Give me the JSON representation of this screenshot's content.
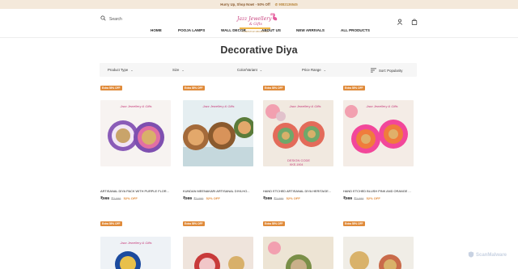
{
  "announcement": {
    "text": "Hurry Up, Shop Now! - 50% Off",
    "phone": "✆ 9082136545"
  },
  "header": {
    "search_label": "Search",
    "logo_text": "Jazz Jewellery & Gifts",
    "logo_subtext": "HOMESTYLE DECORATIVE"
  },
  "nav": [
    "HOME",
    "POOJA LAMPS",
    "WALL DECOR",
    "ABOUT US",
    "NEW ARRIVALS",
    "ALL PRODUCTS"
  ],
  "page_title": "Decorative Diya",
  "filters": {
    "product_type": "Product Type",
    "size": "Size",
    "color": "Color/Variant",
    "price": "Price Range",
    "sort": "Sort: Popularity"
  },
  "products": [
    {
      "badge": "Extra 55% OFF",
      "name": "ARTISANAL DIYA PACK WITH PURPLE FLOR...",
      "price": "₹999",
      "old_price": "₹2,099",
      "discount": "52% OFF",
      "colors": [
        "#8a5cb8",
        "#e26fa4",
        "#d9c03a"
      ]
    },
    {
      "badge": "Extra 55% OFF",
      "name": "KUNDAN MEENAKARI ARTISANAL DIYA HO...",
      "price": "₹999",
      "old_price": "₹2,099",
      "discount": "52% OFF",
      "colors": [
        "#d87a5a",
        "#cfe0e6",
        "#5a7b3a"
      ]
    },
    {
      "badge": "Extra 55% OFF",
      "name": "HAND ETCHED ARTISANAL DIYA HERITAGE...",
      "price": "₹999",
      "old_price": "₹2,099",
      "discount": "52% OFF",
      "colors": [
        "#e36b5a",
        "#6fa86a",
        "#e7d4b8"
      ]
    },
    {
      "badge": "Extra 55% OFF",
      "name": "HAND ETCHED BLUSH PINK AND ORANGE ...",
      "price": "₹999",
      "old_price": "₹2,099",
      "discount": "52% OFF",
      "colors": [
        "#f2479a",
        "#f07c3c",
        "#f4d3d7"
      ]
    }
  ],
  "products_row2": [
    {
      "badge": "Extra 55% OFF",
      "colors": [
        "#1b4a9e",
        "#e8c04a",
        "#e6eef4"
      ]
    },
    {
      "badge": "Extra 55% OFF",
      "colors": [
        "#c83a3a",
        "#f1c6c8",
        "#e9d6c4"
      ]
    },
    {
      "badge": "Extra 55% OFF",
      "colors": [
        "#7a8f48",
        "#c9b08a",
        "#ede4d4"
      ]
    },
    {
      "badge": "Extra 55% OFF",
      "colors": [
        "#d9b26a",
        "#f0ede6",
        "#c96b4a"
      ]
    }
  ],
  "watermark": "ScanMalware"
}
